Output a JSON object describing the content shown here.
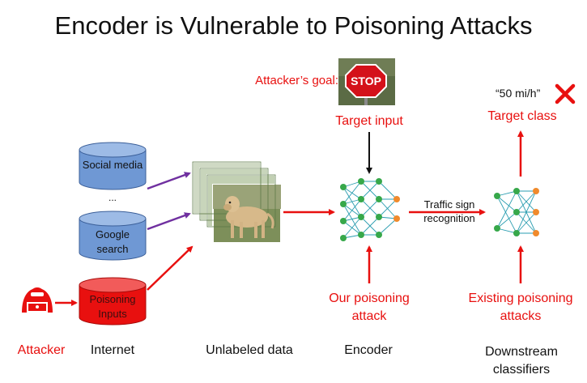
{
  "title": "Encoder is Vulnerable to Poisoning Attacks",
  "goal": {
    "label": "Attacker’s goal:",
    "stop_sign_text": "STOP"
  },
  "target_input": "Target input",
  "target_class": "Target class",
  "predicted_label": "“50 mi/h”",
  "sources": {
    "social_media": "Social media",
    "ellipsis": "...",
    "google_search": "Google search",
    "poisoning_inputs": "Poisoning Inputs"
  },
  "edge_label": "Traffic sign recognition",
  "our_attack": "Our poisoning attack",
  "existing_attacks": "Existing poisoning attacks",
  "bottom_labels": {
    "attacker": "Attacker",
    "internet": "Internet",
    "unlabeled_data": "Unlabeled data",
    "encoder": "Encoder",
    "downstream": "Downstream classifiers"
  },
  "colors": {
    "red": "#e8100f",
    "purple": "#7030a0",
    "blue_cylinder": "#6f98d4",
    "red_cylinder": "#e8100f",
    "node_green": "#37a84a",
    "node_orange": "#f08a2c",
    "edge_teal": "#2a9db0"
  }
}
